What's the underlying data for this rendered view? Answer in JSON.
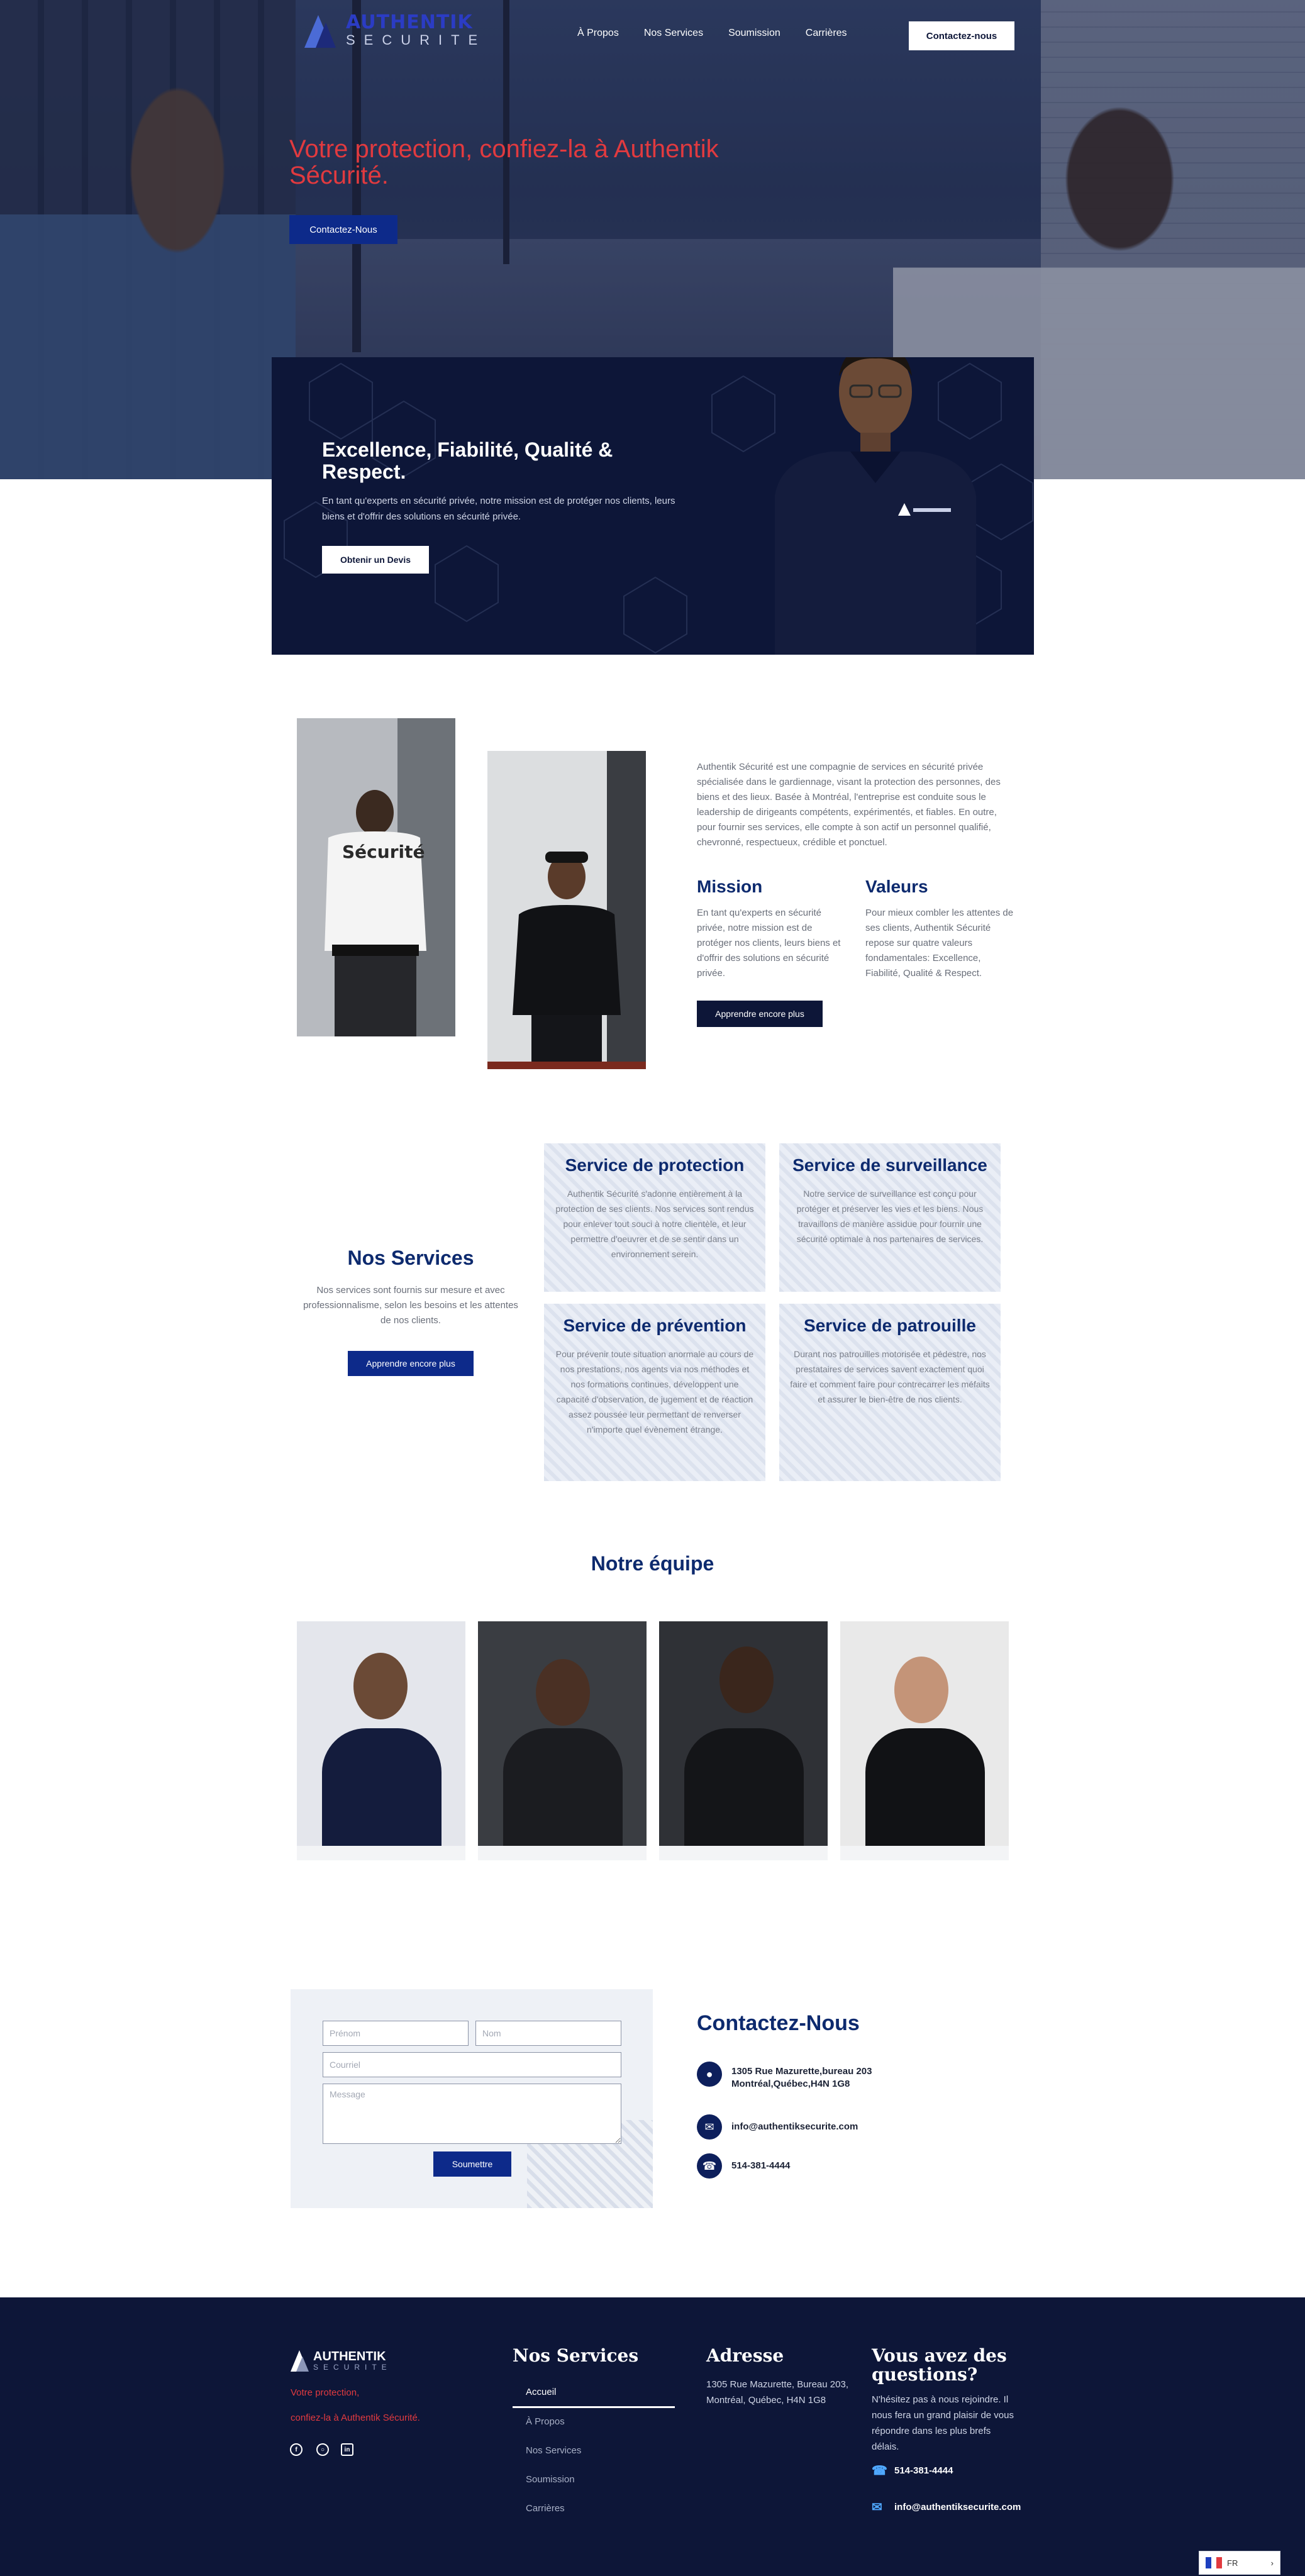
{
  "brand": {
    "line1": "AUTHENTIK",
    "line2": "SECURITE",
    "accent": "#e13a3f",
    "navy": "#0d1638",
    "blue": "#0d2a8a"
  },
  "nav": {
    "items": [
      "À Propos",
      "Nos Services",
      "Soumission",
      "Carrières"
    ],
    "cta": "Contactez-nous"
  },
  "hero": {
    "title": "Votre protection, confiez-la à Authentik Sécurité.",
    "cta": "Contactez-Nous"
  },
  "excellence": {
    "title": "Excellence, Fiabilité, Qualité & Respect.",
    "desc": "En tant qu'experts en sécurité privée, notre mission est de protéger nos clients, leurs biens et d'offrir des solutions en sécurité privée.",
    "cta": "Obtenir un Devis"
  },
  "about": {
    "text": "Authentik Sécurité est une compagnie de services en sécurité privée spécialisée dans le gardiennage, visant la protection des personnes, des biens et des lieux. Basée à Montréal, l'entreprise est conduite sous le leadership de dirigeants compétents, expérimentés, et fiables. En outre, pour fournir ses services, elle compte à son actif un personnel qualifié, chevronné, respectueux, crédible et ponctuel.",
    "shirt_text": "Sécurité",
    "mission": {
      "title": "Mission",
      "text": "En tant qu'experts en sécurité privée, notre mission est de protéger nos clients, leurs biens et d'offrir des solutions en sécurité privée."
    },
    "values": {
      "title": "Valeurs",
      "text": "Pour mieux combler les attentes de ses clients, Authentik Sécurité repose sur quatre valeurs fondamentales: Excellence, Fiabilité, Qualité & Respect."
    },
    "cta": "Apprendre encore plus"
  },
  "services": {
    "title": "Nos Services",
    "intro": "Nos services sont fournis sur mesure et avec professionnalisme, selon les besoins et les attentes de nos clients.",
    "cta": "Apprendre encore plus",
    "cards": [
      {
        "title": "Service de protection",
        "text": "Authentik Sécurité s'adonne entièrement à la protection de ses clients. Nos services sont rendus pour enlever tout souci à notre clientèle, et leur permettre d'oeuvrer et de se sentir dans un environnement serein."
      },
      {
        "title": "Service de surveillance",
        "text": "Notre service de surveillance est conçu pour protéger et préserver les vies et les biens. Nous travaillons de manière assidue pour fournir une sécurité optimale à nos partenaires de services."
      },
      {
        "title": "Service de prévention",
        "text": "Pour prévenir toute situation anormale au cours de nos prestations, nos agents via nos méthodes et nos formations continues, développent une capacité d'observation, de jugement et de réaction assez poussée leur permettant de renverser n'importe quel évènement étrange."
      },
      {
        "title": "Service de patrouille",
        "text": "Durant nos patrouilles motorisée et pédestre, nos prestataires de services savent exactement quoi faire et comment faire pour contrecarrer les méfaits et assurer le bien-être de nos clients."
      }
    ]
  },
  "team": {
    "title": "Notre équipe",
    "count": 4
  },
  "contact": {
    "form": {
      "first_name_placeholder": "Prénom",
      "last_name_placeholder": "Nom",
      "email_placeholder": "Courriel",
      "message_placeholder": "Message",
      "submit": "Soumettre"
    },
    "title": "Contactez-Nous",
    "address_line1": "1305 Rue Mazurette,bureau 203",
    "address_line2": "Montréal,Québec,H4N 1G8",
    "email": "info@authentiksecurite.com",
    "phone": "514-381-4444"
  },
  "footer": {
    "logo_line1": "AUTHENTIK",
    "logo_line2": "SECURITE",
    "tagline1": "Votre protection,",
    "tagline2": "confiez-la à Authentik Sécurité.",
    "social": [
      "facebook-icon",
      "instagram-icon",
      "linkedin-icon"
    ],
    "services_title": "Nos Services",
    "links": [
      "Accueil",
      "À Propos",
      "Nos Services",
      "Soumission",
      "Carrières"
    ],
    "address_title": "Adresse",
    "address": "1305 Rue Mazurette, Bureau 203, Montréal, Québec, H4N 1G8",
    "questions_title": "Vous avez des questions?",
    "questions_text": "N'hésitez pas à nous rejoindre. Il nous fera un grand plaisir de vous répondre dans les plus brefs délais.",
    "phone": "514-381-4444",
    "email": "info@authentiksecurite.com"
  },
  "language": {
    "code": "FR"
  }
}
